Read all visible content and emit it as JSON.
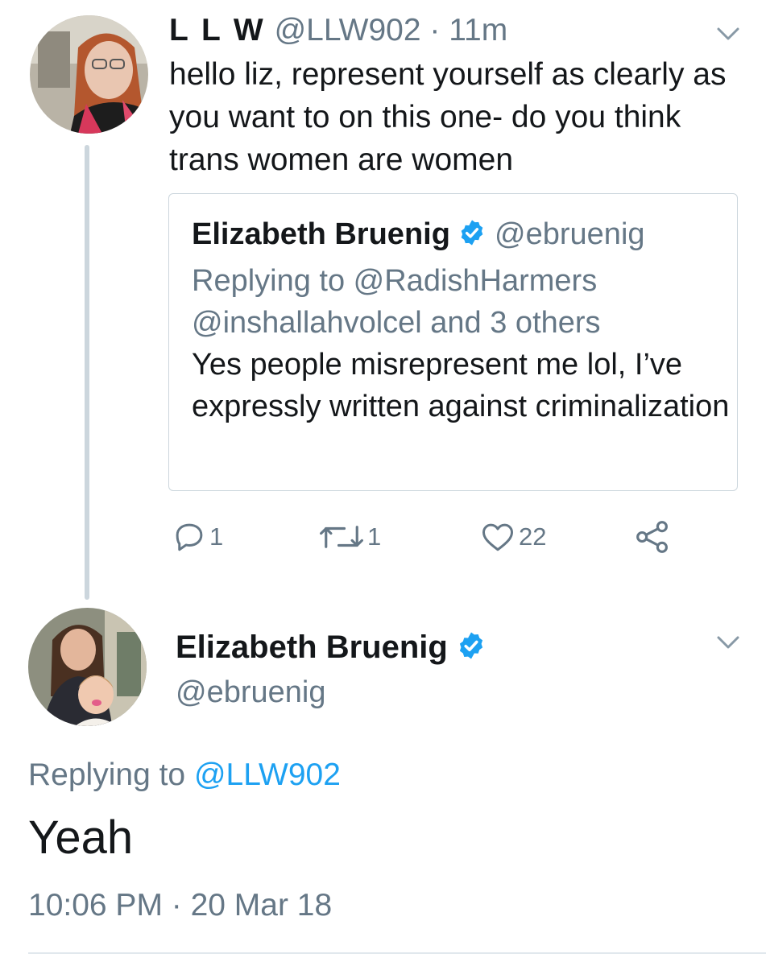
{
  "tweet1": {
    "name": "L L W",
    "handle": "@LLW902",
    "separator": "·",
    "time": "11m",
    "text": "hello liz, represent yourself as clearly as you want to on this one- do you think trans women are women",
    "quoted": {
      "name": "Elizabeth Bruenig",
      "handle": "@ebruenig",
      "replying_line1": "Replying to @RadishHarmers",
      "replying_line2": "@inshallahvolcel and 3 others",
      "text": "Yes people misrepresent me lol, I’ve expressly written against criminalization"
    },
    "actions": {
      "reply_count": "1",
      "retweet_count": "1",
      "like_count": "22"
    }
  },
  "tweet2": {
    "name": "Elizabeth Bruenig",
    "handle": "@ebruenig",
    "replying_prefix": "Replying to",
    "replying_to": "@LLW902",
    "text": "Yeah",
    "timestamp": "10:06 PM · 20 Mar 18"
  },
  "colors": {
    "text": "#14171a",
    "secondary": "#657786",
    "link": "#1da1f2",
    "border": "#ccd6dd"
  },
  "icons": [
    "chevron-down-icon",
    "verified-badge-icon",
    "reply-icon",
    "retweet-icon",
    "like-icon",
    "share-icon"
  ]
}
